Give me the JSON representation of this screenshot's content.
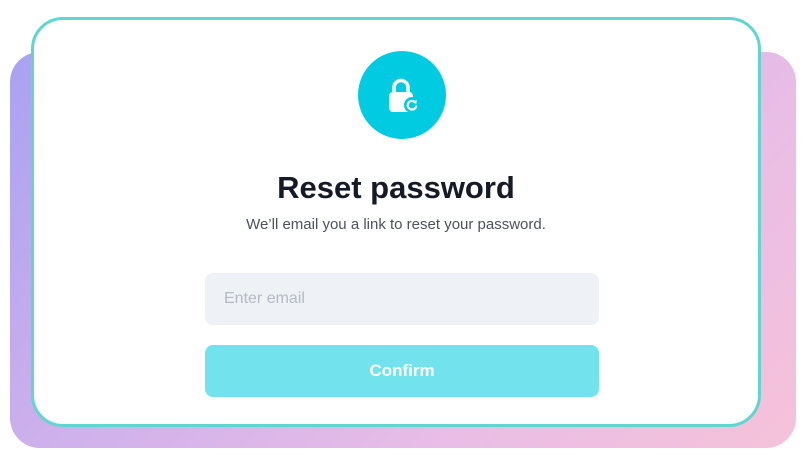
{
  "dialog": {
    "icon": "lock-reset-icon",
    "title": "Reset password",
    "subtitle": "We’ll email you a link to reset your password.",
    "email_field": {
      "value": "",
      "placeholder": "Enter email"
    },
    "confirm_label": "Confirm"
  },
  "colors": {
    "accent": "#00cbe1",
    "button": "#72e3ed",
    "card_border": "#5fd6cf",
    "input_background": "#eef2f6",
    "backdrop_gradient": [
      "#a8a2f2",
      "#f5c2d9"
    ]
  }
}
